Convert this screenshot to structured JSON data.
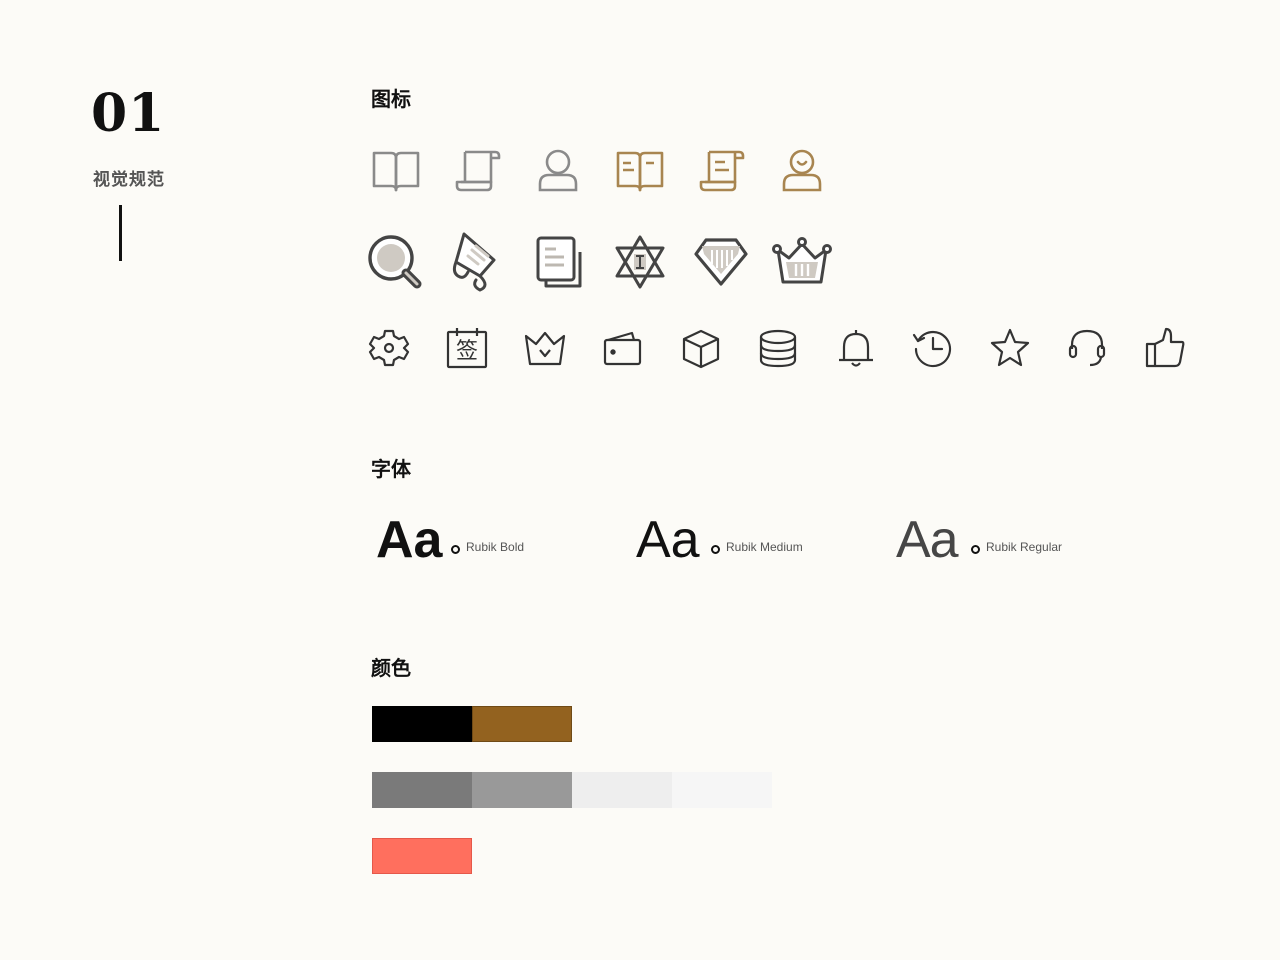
{
  "section": {
    "number": "01",
    "subtitle": "视觉规范"
  },
  "headings": {
    "icons": "图标",
    "fonts": "字体",
    "colors": "颜色"
  },
  "icons": {
    "row1": [
      "book-outline-icon",
      "scroll-outline-icon",
      "user-outline-icon",
      "book-gold-icon",
      "scroll-gold-icon",
      "user-gold-icon"
    ],
    "row2": [
      "search-icon",
      "scroll-unrolled-icon",
      "document-stack-icon",
      "star-of-david-icon",
      "diamond-icon",
      "crown-icon"
    ],
    "row3": [
      "gear-icon",
      "calendar-sign-icon",
      "crown-line-icon",
      "wallet-icon",
      "box-icon",
      "database-icon",
      "bell-icon",
      "history-icon",
      "star-icon",
      "headset-icon",
      "thumbs-up-icon"
    ],
    "sign_glyph": "签"
  },
  "fonts": [
    {
      "sample": "Aa",
      "name": "Rubik Bold"
    },
    {
      "sample": "Aa",
      "name": "Rubik Medium"
    },
    {
      "sample": "Aa",
      "name": "Rubik Regular"
    }
  ],
  "colors": {
    "primary": [
      "#000000",
      "#93621f"
    ],
    "grays": [
      "#7a7a7a",
      "#999999",
      "#eeeeee",
      "#f6f6f6"
    ],
    "accent": [
      "#ff6f5e"
    ]
  }
}
